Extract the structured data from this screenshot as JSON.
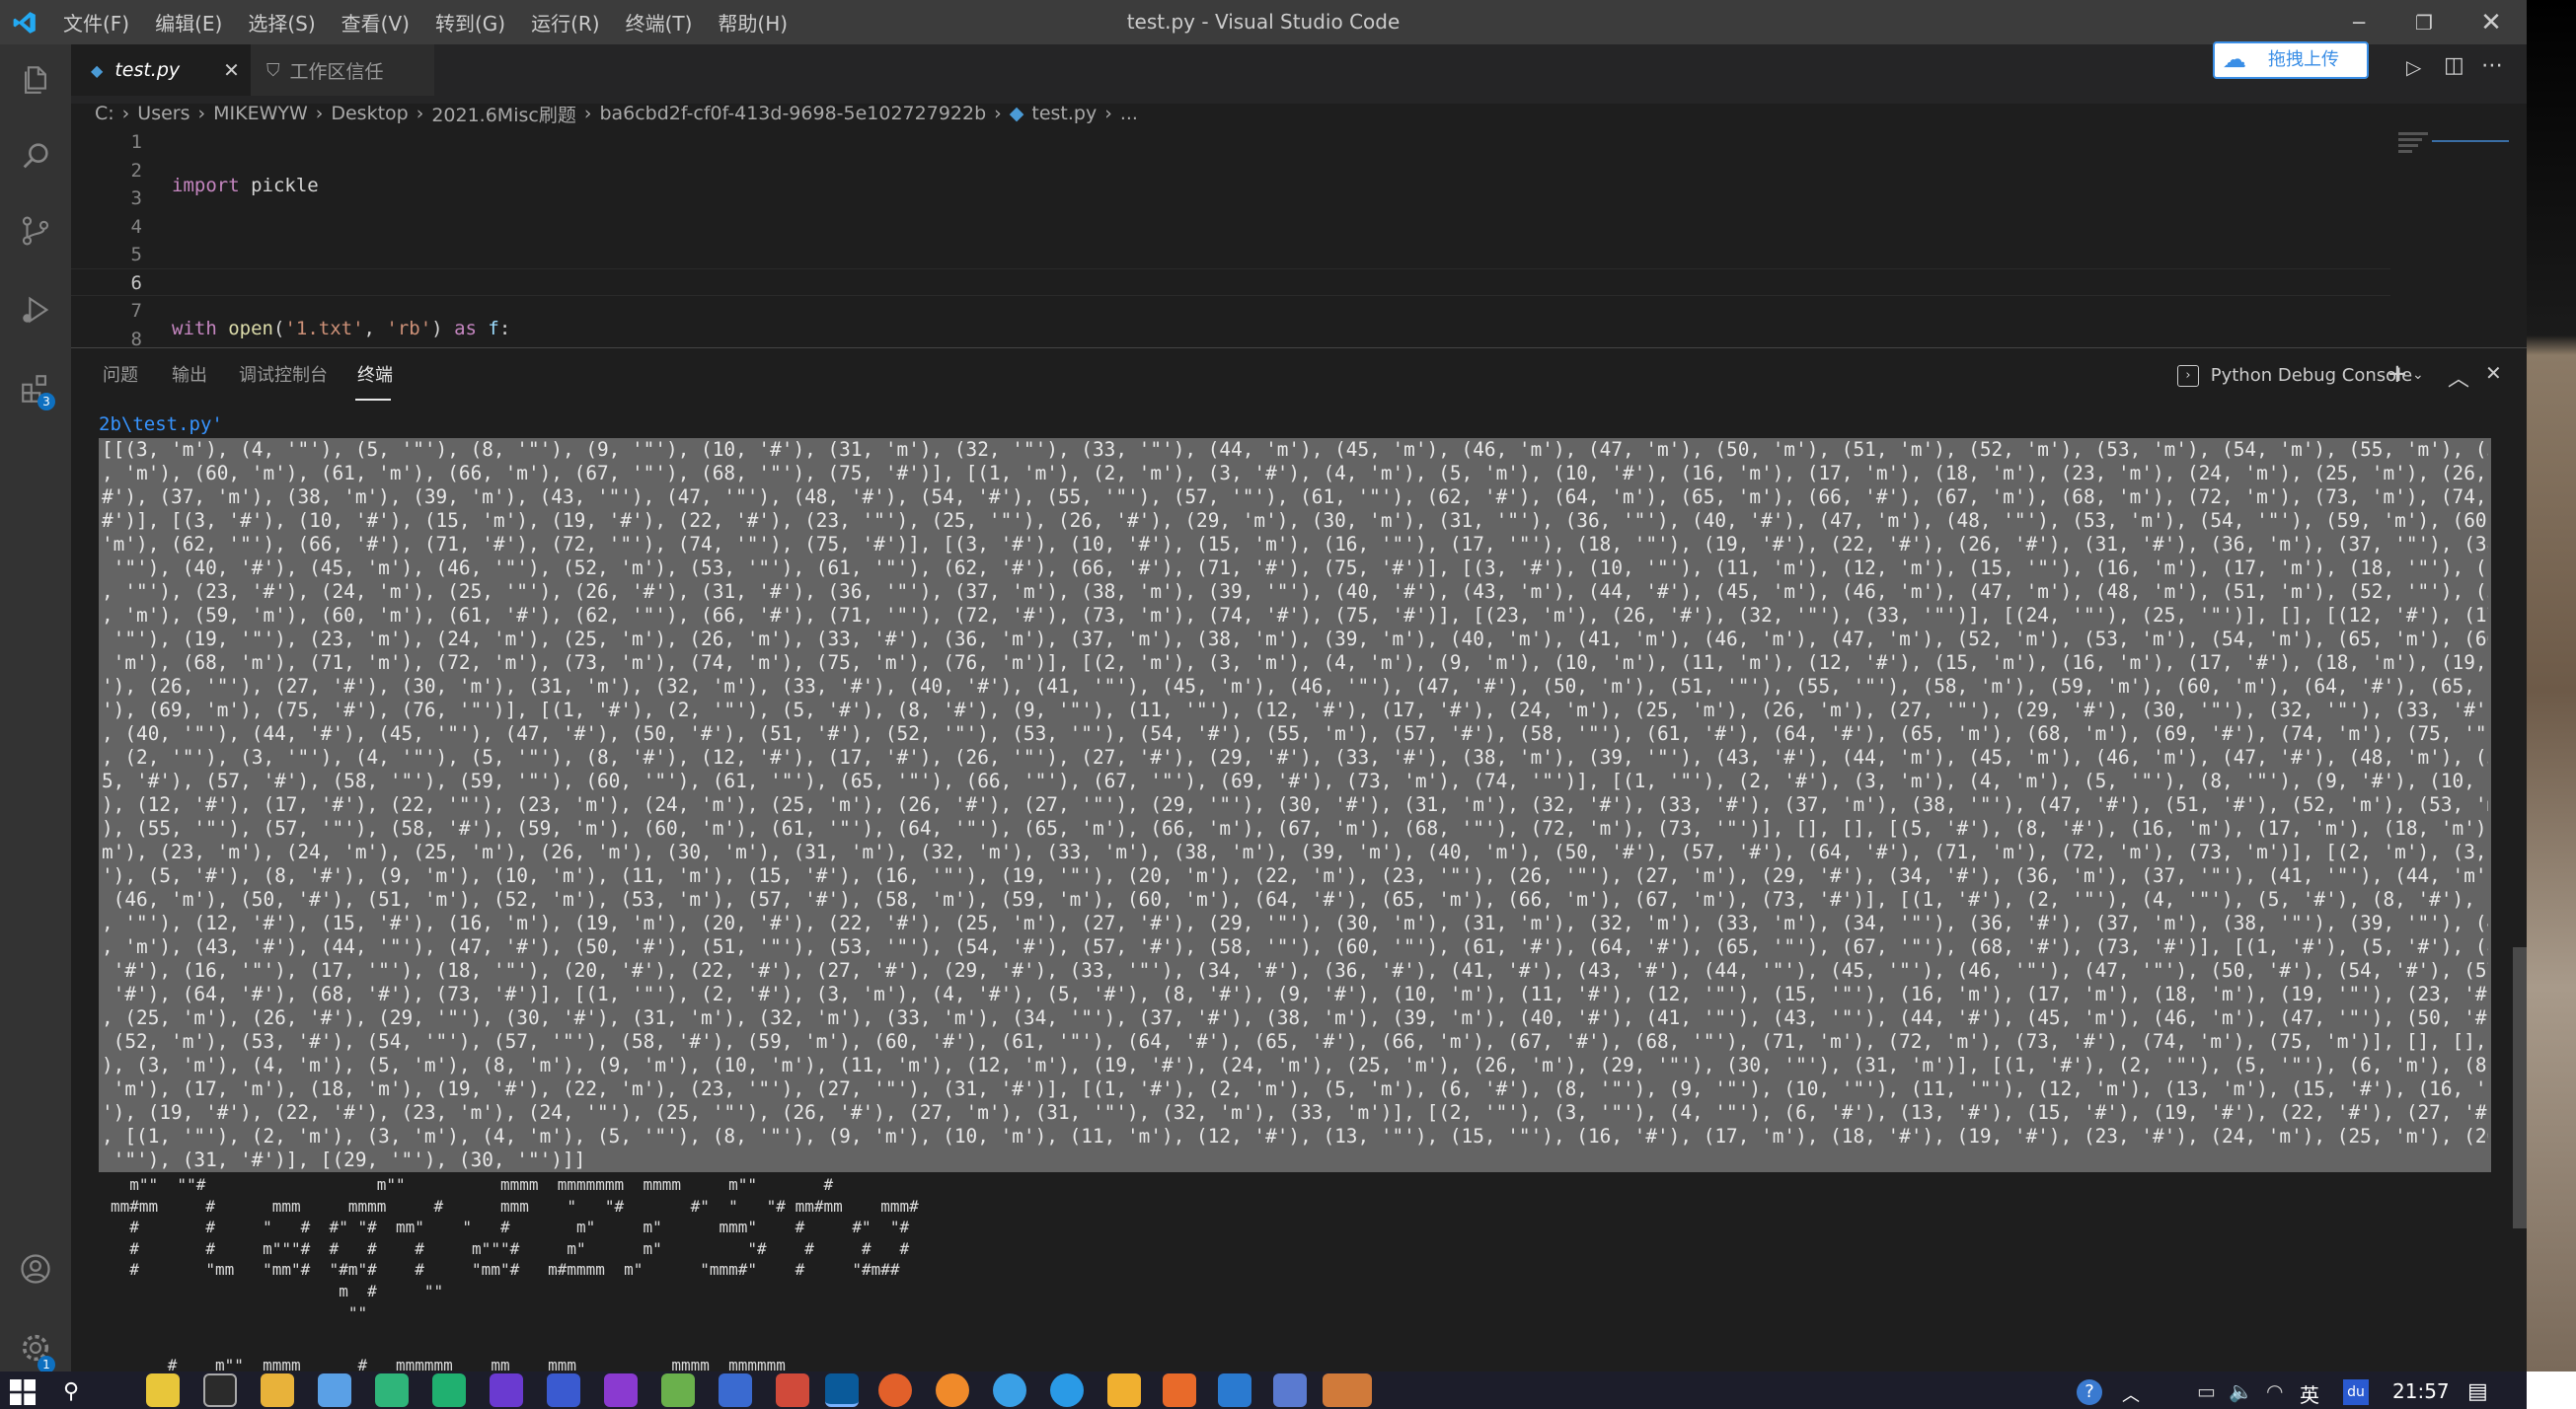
{
  "app": {
    "title": "test.py - Visual Studio Code",
    "menu": [
      "文件(F)",
      "编辑(E)",
      "选择(S)",
      "查看(V)",
      "转到(G)",
      "运行(R)",
      "终端(T)",
      "帮助(H)"
    ]
  },
  "tabs": [
    {
      "label": "test.py",
      "active": true
    },
    {
      "label": "工作区信任",
      "active": false
    }
  ],
  "upload_button": "拖拽上传",
  "breadcrumb": [
    "C:",
    "Users",
    "MIKEWYW",
    "Desktop",
    "2021.6Misc刷题",
    "ba6cbd2f-cf0f-413d-9698-5e102727922b",
    "test.py",
    "..."
  ],
  "activity_badges": {
    "extensions": "3",
    "settings": "1"
  },
  "editor": {
    "line_numbers": [
      "1",
      "2",
      "3",
      "4",
      "5",
      "6",
      "7",
      "8"
    ],
    "active_line": "6"
  },
  "panel": {
    "tabs": [
      "问题",
      "输出",
      "调试控制台",
      "终端"
    ],
    "active_tab": "终端",
    "terminal_name": "Python Debug Console"
  },
  "terminal": {
    "path_line": "2b\\test.py'",
    "output_lines": [
      "[[(3, 'm'), (4, '\"'), (5, '\"'), (8, '\"'), (9, '\"'), (10, '#'), (31, 'm'), (32, '\"'), (33, '\"'), (44, 'm'), (45, 'm'), (46, 'm'), (47, 'm'), (50, 'm'), (51, 'm'), (52, 'm'), (53, 'm'), (54, 'm'), (55, 'm'), (58, 'm'), (59",
      ", 'm'), (60, 'm'), (61, 'm'), (66, 'm'), (67, '\"'), (68, '\"'), (75, '#')], [(1, 'm'), (2, 'm'), (3, '#'), (4, 'm'), (5, 'm'), (10, '#'), (16, 'm'), (17, 'm'), (18, 'm'), (23, 'm'), (24, 'm'), (25, 'm'), (26, 'm'), (31, '",
      "#'), (37, 'm'), (38, 'm'), (39, 'm'), (43, '\"'), (47, '\"'), (48, '#'), (54, '#'), (55, '\"'), (57, '\"'), (61, '\"'), (62, '#'), (64, 'm'), (65, 'm'), (66, '#'), (67, 'm'), (68, 'm'), (72, 'm'), (73, 'm'), (74, 'm'), (75, '",
      "#')], [(3, '#'), (10, '#'), (15, 'm'), (19, '#'), (22, '#'), (23, '\"'), (25, '\"'), (26, '#'), (29, 'm'), (30, 'm'), (31, '\"'), (36, '\"'), (40, '#'), (47, 'm'), (48, '\"'), (53, 'm'), (54, '\"'), (59, 'm'), (60, 'm'), (61,",
      "'m'), (62, '\"'), (66, '#'), (71, '#'), (72, '\"'), (74, '\"'), (75, '#')], [(3, '#'), (10, '#'), (15, 'm'), (16, '\"'), (17, '\"'), (18, '\"'), (19, '#'), (22, '#'), (26, '#'), (31, '#'), (36, 'm'), (37, '\"'), (38, '\"'), (39,",
      " '\"'), (40, '#'), (45, 'm'), (46, '\"'), (52, 'm'), (53, '\"'), (61, '\"'), (62, '#'), (66, '#'), (71, '#'), (75, '#')], [(3, '#'), (10, '\"'), (11, 'm'), (12, 'm'), (15, '\"'), (16, 'm'), (17, 'm'), (18, '\"'), (19, '#'), (22",
      ", '\"'), (23, '#'), (24, 'm'), (25, '\"'), (26, '#'), (31, '#'), (36, '\"'), (37, 'm'), (38, 'm'), (39, '\"'), (40, '#'), (43, 'm'), (44, '#'), (45, 'm'), (46, 'm'), (47, 'm'), (48, 'm'), (51, 'm'), (52, '\"'), (57, '\"'), (58",
      ", 'm'), (59, 'm'), (60, 'm'), (61, '#'), (62, '\"'), (66, '#'), (71, '\"'), (72, '#'), (73, 'm'), (74, '#'), (75, '#')], [(23, 'm'), (26, '#'), (32, '\"'), (33, '\"')], [(24, '\"'), (25, '\"')], [], [(12, '#'), (17, 'm'), (18,",
      " '\"'), (19, '\"'), (23, 'm'), (24, 'm'), (25, 'm'), (26, 'm'), (33, '#'), (36, 'm'), (37, 'm'), (38, 'm'), (39, 'm'), (40, 'm'), (41, 'm'), (46, 'm'), (47, 'm'), (52, 'm'), (53, 'm'), (54, 'm'), (65, 'm'), (66, 'm'), (67,",
      " 'm'), (68, 'm'), (71, 'm'), (72, 'm'), (73, 'm'), (74, 'm'), (75, 'm'), (76, 'm')], [(2, 'm'), (3, 'm'), (4, 'm'), (9, 'm'), (10, 'm'), (11, 'm'), (12, '#'), (15, 'm'), (16, 'm'), (17, '#'), (18, 'm'), (19, 'm'), (22, '",
      "'), (26, '\"'), (27, '#'), (30, 'm'), (31, 'm'), (32, 'm'), (33, '#'), (40, '#'), (41, '\"'), (45, 'm'), (46, '\"'), (47, '#'), (50, 'm'), (51, '\"'), (55, '\"'), (58, 'm'), (59, 'm'), (60, 'm'), (64, '#'), (65, '\"'), (68, '",
      "'), (69, 'm'), (75, '#'), (76, '\"')], [(1, '#'), (2, '\"'), (5, '#'), (8, '#'), (9, '\"'), (11, '\"'), (12, '#'), (17, '#'), (24, 'm'), (25, 'm'), (26, 'm'), (27, '\"'), (29, '#'), (30, '\"'), (32, '\"'), (33, '#'), (39, 'm')",
      ", (40, '\"'), (44, '#'), (45, '\"'), (47, '#'), (50, '#'), (51, '#'), (52, '\"'), (53, '\"'), (54, '#'), (55, 'm'), (57, '#'), (58, '\"'), (61, '#'), (64, '#'), (65, 'm'), (68, 'm'), (69, '#'), (74, 'm'), (75, '\"')], [(1, '#')",
      ", (2, '\"'), (3, '\"'), (4, '\"'), (5, '\"'), (8, '#'), (12, '#'), (17, '#'), (26, '\"'), (27, '#'), (29, '#'), (33, '#'), (38, 'm'), (39, '\"'), (43, '#'), (44, 'm'), (45, 'm'), (46, 'm'), (47, '#'), (48, 'm'), (50, '#'), (5",
      "5, '#'), (57, '#'), (58, '\"'), (59, '\"'), (60, '\"'), (61, '\"'), (65, '\"'), (66, '\"'), (67, '\"'), (69, '#'), (73, 'm'), (74, '\"')], [(1, '\"'), (2, '#'), (3, 'm'), (4, 'm'), (5, '\"'), (8, '\"'), (9, '#'), (10, 'm'), (11, '#'",
      "), (12, '#'), (17, '#'), (22, '\"'), (23, 'm'), (24, 'm'), (25, 'm'), (26, '#'), (27, '\"'), (29, '\"'), (30, '#'), (31, 'm'), (32, '#'), (33, '#'), (37, 'm'), (38, '\"'), (47, '#'), (51, '#'), (52, 'm'), (53, 'm'), (54, '#'",
      "), (55, '\"'), (57, '\"'), (58, '#'), (59, 'm'), (60, 'm'), (61, '\"'), (64, '\"'), (65, 'm'), (66, 'm'), (67, 'm'), (68, '\"'), (72, 'm'), (73, '\"')], [], [], [(5, '#'), (8, '#'), (16, 'm'), (17, 'm'), (18, 'm'), (19, '",
      "m'), (23, 'm'), (24, 'm'), (25, 'm'), (26, 'm'), (30, 'm'), (31, 'm'), (32, 'm'), (33, 'm'), (38, 'm'), (39, 'm'), (40, 'm'), (50, '#'), (57, '#'), (64, '#'), (71, 'm'), (72, 'm'), (73, 'm')], [(2, 'm'), (3, 'm'), (4, 'm",
      "'), (5, '#'), (8, '#'), (9, 'm'), (10, 'm'), (11, 'm'), (15, '#'), (16, '\"'), (19, '\"'), (20, 'm'), (22, 'm'), (23, '\"'), (26, '\"'), (27, 'm'), (29, '#'), (34, '#'), (36, 'm'), (37, '\"'), (41, '\"'), (44, 'm'), (45, 'm'),",
      " (46, 'm'), (50, '#'), (51, 'm'), (52, 'm'), (53, 'm'), (57, '#'), (58, 'm'), (59, 'm'), (60, 'm'), (64, '#'), (65, 'm'), (66, 'm'), (67, 'm'), (73, '#')], [(1, '#'), (2, '\"'), (4, '\"'), (5, '#'), (8, '#'), (9, '\"'), (11",
      ", '\"'), (12, '#'), (15, '#'), (16, 'm'), (19, 'm'), (20, '#'), (22, '#'), (25, 'm'), (27, '#'), (29, '\"'), (30, 'm'), (31, 'm'), (32, 'm'), (33, 'm'), (34, '\"'), (36, '#'), (37, 'm'), (38, '\"'), (39, '\"'), (40, '#'), (41",
      ", 'm'), (43, '#'), (44, '\"'), (47, '#'), (50, '#'), (51, '\"'), (53, '\"'), (54, '#'), (57, '#'), (58, '\"'), (60, '\"'), (61, '#'), (64, '#'), (65, '\"'), (67, '\"'), (68, '#'), (73, '#')], [(1, '#'), (5, '#'), (8, '#'), (12,",
      " '#'), (16, '\"'), (17, '\"'), (18, '\"'), (20, '#'), (22, '#'), (27, '#'), (29, '#'), (33, '\"'), (34, '#'), (36, '#'), (41, '#'), (43, '#'), (44, '\"'), (45, '\"'), (46, '\"'), (47, '\"'), (50, '#'), (54, '#'), (57, '#'), (61,",
      " '#'), (64, '#'), (68, '#'), (73, '#')], [(1, '\"'), (2, '#'), (3, 'm'), (4, '#'), (5, '#'), (8, '#'), (9, '#'), (10, 'm'), (11, '#'), (12, '\"'), (15, '\"'), (16, 'm'), (17, 'm'), (18, 'm'), (19, '\"'), (23, '#'), (24, 'm')",
      ", (25, 'm'), (26, '#'), (29, '\"'), (30, '#'), (31, 'm'), (32, 'm'), (33, 'm'), (34, '\"'), (37, '#'), (38, 'm'), (39, 'm'), (40, '#'), (41, '\"'), (43, '\"'), (44, '#'), (45, 'm'), (46, 'm'), (47, '\"'), (50, '#'), (51, '#'),",
      " (52, 'm'), (53, '#'), (54, '\"'), (57, '\"'), (58, '#'), (59, 'm'), (60, '#'), (61, '\"'), (64, '#'), (65, '#'), (66, 'm'), (67, '#'), (68, '\"'), (71, 'm'), (72, 'm'), (73, '#'), (74, 'm'), (75, 'm')], [], [], [], [(2, 'm'",
      "), (3, 'm'), (4, 'm'), (5, 'm'), (8, 'm'), (9, 'm'), (10, 'm'), (11, 'm'), (12, 'm'), (19, '#'), (24, 'm'), (25, 'm'), (26, 'm'), (29, '\"'), (30, '\"'), (31, 'm')], [(1, '#'), (2, '\"'), (5, '\"'), (6, 'm'), (8, '#'), (16,",
      " 'm'), (17, 'm'), (18, 'm'), (19, '#'), (22, 'm'), (23, '\"'), (27, '\"'), (31, '#')], [(1, '#'), (2, 'm'), (5, 'm'), (6, '#'), (8, '\"'), (9, '\"'), (10, '\"'), (11, '\"'), (12, 'm'), (13, 'm'), (15, '#'), (16, '\"'), (18, '\"",
      "'), (19, '#'), (22, '#'), (23, 'm'), (24, '\"'), (25, '\"'), (26, '#'), (27, 'm'), (31, '\"'), (32, 'm'), (33, 'm')], [(2, '\"'), (3, '\"'), (4, '\"'), (6, '#'), (13, '#'), (15, '#'), (19, '#'), (22, '#'), (27, '#'), (31, '#')",
      ", [(1, '\"'), (2, 'm'), (3, 'm'), (4, 'm'), (5, '\"'), (8, '\"'), (9, 'm'), (10, 'm'), (11, 'm'), (12, '#'), (13, '\"'), (15, '\"'), (16, '#'), (17, 'm'), (18, '#'), (19, '#'), (23, '#'), (24, 'm'), (25, 'm'), (26, '#'), (27,",
      " '\"'), (31, '#')], [(29, '\"'), (30, '\"')]]"
    ],
    "ascii_art": [
      "  m\"\"  \"\"#                  m\"\"          mmmm  mmmmmmm  mmmm     m\"\"       #",
      "mm#mm     #      mmm     mmmm     #      mmm    \"   \"#       #\"  \"   \"# mm#mm    mmm#",
      "  #       #     \"   #  #\" \"#  mm\"    \"   #       m\"     m\"      mmm\"    #     #\"  \"#",
      "  #       #     m\"\"\"#  #   #    #     m\"\"\"#     m\"      m\"         \"#    #     #   #",
      "  #       \"mm   \"mm\"#  \"#m\"#    #     \"mm\"#   m#mmmm  m\"      \"mmm#\"    #     \"#m##",
      "                        m  #     \"\"",
      "                         \"\""
    ],
    "ascii_art_next": "      #    m\"\"  mmmm      #   mmmmmm    mm    mmm          mmmm  mmmmmm"
  },
  "taskbar": {
    "ime": "英",
    "clock": "21:57"
  }
}
